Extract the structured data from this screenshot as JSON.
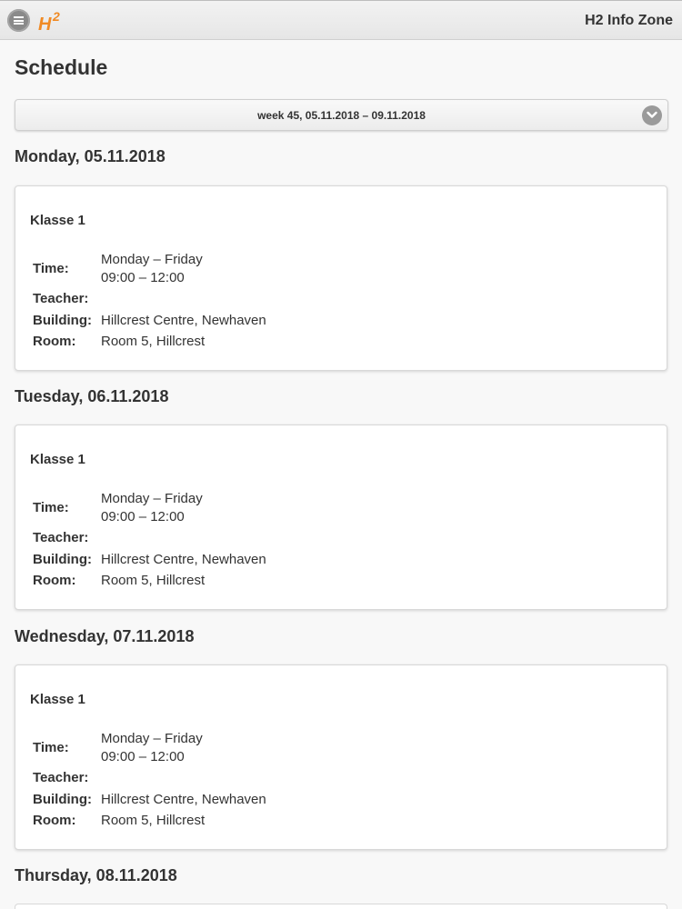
{
  "header": {
    "logo_text": "H2",
    "title": "H2 Info Zone"
  },
  "page_title": "Schedule",
  "week_selector": {
    "value": "week 45, 05.11.2018 – 09.11.2018"
  },
  "labels": {
    "time": "Time:",
    "teacher": "Teacher:",
    "building": "Building:",
    "room": "Room:"
  },
  "days": [
    {
      "heading": "Monday, 05.11.2018",
      "klasse": "Klasse 1",
      "time_days": "Monday – Friday",
      "time_hours": "09:00 – 12:00",
      "teacher": "",
      "building": "Hillcrest Centre, Newhaven",
      "room": "Room 5, Hillcrest"
    },
    {
      "heading": "Tuesday, 06.11.2018",
      "klasse": "Klasse 1",
      "time_days": "Monday – Friday",
      "time_hours": "09:00 – 12:00",
      "teacher": "",
      "building": "Hillcrest Centre, Newhaven",
      "room": "Room 5, Hillcrest"
    },
    {
      "heading": "Wednesday, 07.11.2018",
      "klasse": "Klasse 1",
      "time_days": "Monday – Friday",
      "time_hours": "09:00 – 12:00",
      "teacher": "",
      "building": "Hillcrest Centre, Newhaven",
      "room": "Room 5, Hillcrest"
    },
    {
      "heading": "Thursday, 08.11.2018"
    }
  ],
  "colors": {
    "brand_orange": "#f08a24",
    "background": "#f8f8f8"
  }
}
